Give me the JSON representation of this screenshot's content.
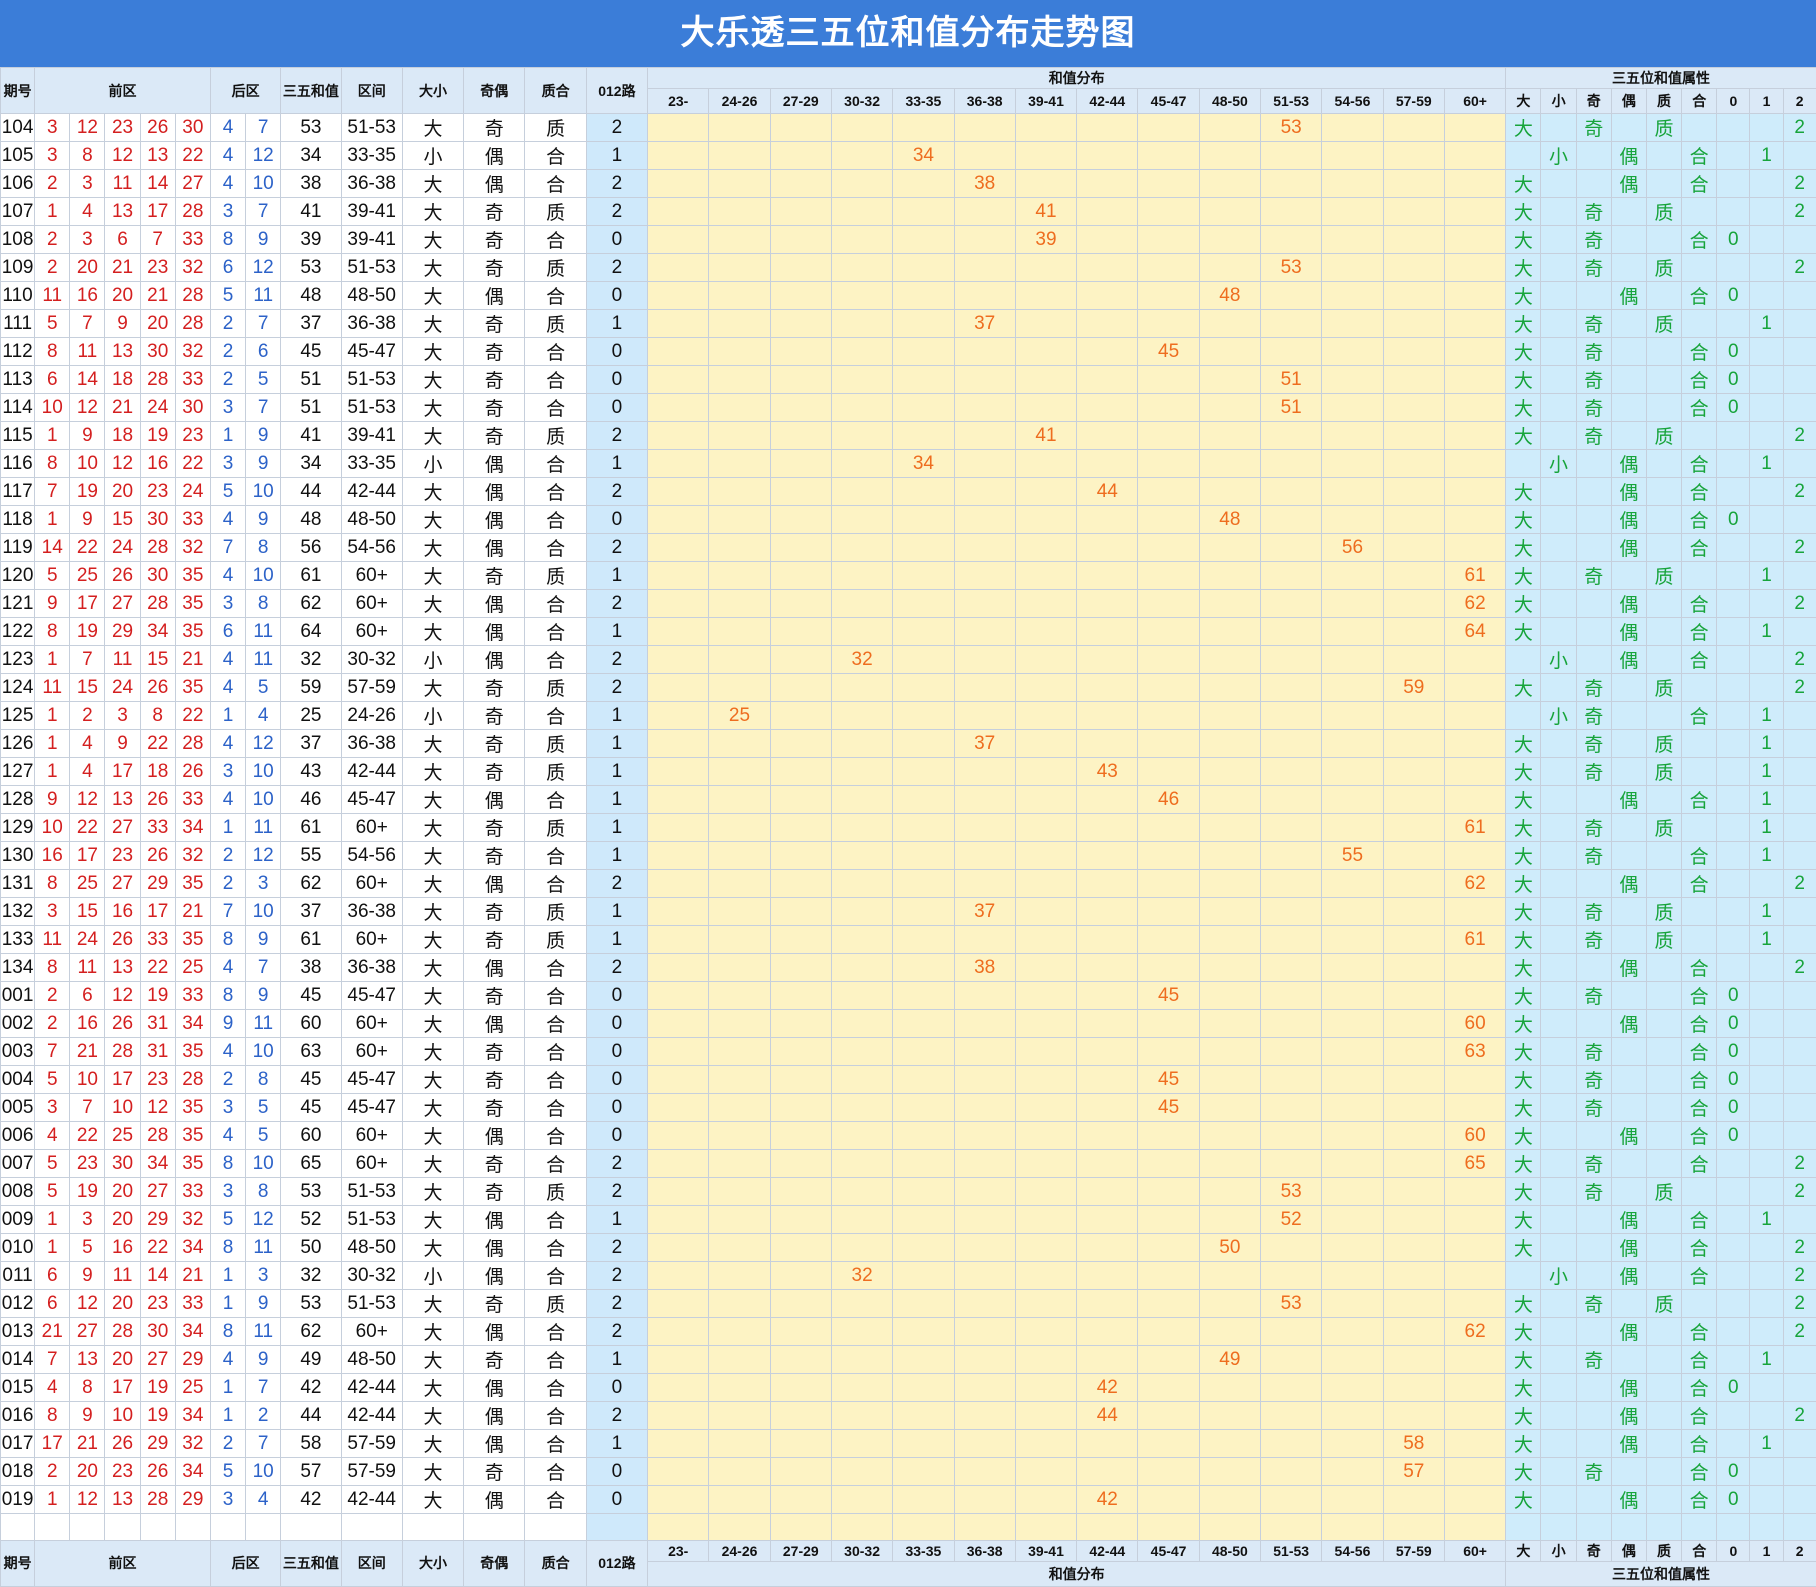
{
  "title": "大乐透三五位和值分布走势图",
  "headers": {
    "period": "期号",
    "front": "前区",
    "back": "后区",
    "sum": "三五和值",
    "segment": "区间",
    "size": "大小",
    "odd_even": "奇偶",
    "prime": "质合",
    "route": "012路",
    "dist_title": "和值分布",
    "dist_cols": [
      "23-",
      "24-26",
      "27-29",
      "30-32",
      "33-35",
      "36-38",
      "39-41",
      "42-44",
      "45-47",
      "48-50",
      "51-53",
      "54-56",
      "57-59",
      "60+"
    ],
    "attr_title": "三五位和值属性",
    "attr_cols": [
      "大",
      "小",
      "奇",
      "偶",
      "质",
      "合",
      "0",
      "1",
      "2"
    ]
  },
  "colors": {
    "title_bg": "#3b7dd8",
    "dist_bg": "#fdf3c4",
    "attr_bg": "#cfecfb",
    "front": "#d41f1f",
    "back": "#2c62c8",
    "dist_text": "#ee6d1f",
    "attr_text": "#17a43b"
  },
  "chart_data": {
    "type": "table",
    "rows": [
      {
        "p": "104",
        "f": [
          3,
          12,
          23,
          26,
          30
        ],
        "b": [
          4,
          7
        ],
        "s": 53,
        "seg": "51-53",
        "dx": "大",
        "jo": "奇",
        "zh": "质",
        "r": 2
      },
      {
        "p": "105",
        "f": [
          3,
          8,
          12,
          13,
          22
        ],
        "b": [
          4,
          12
        ],
        "s": 34,
        "seg": "33-35",
        "dx": "小",
        "jo": "偶",
        "zh": "合",
        "r": 1
      },
      {
        "p": "106",
        "f": [
          2,
          3,
          11,
          14,
          27
        ],
        "b": [
          4,
          10
        ],
        "s": 38,
        "seg": "36-38",
        "dx": "大",
        "jo": "偶",
        "zh": "合",
        "r": 2
      },
      {
        "p": "107",
        "f": [
          1,
          4,
          13,
          17,
          28
        ],
        "b": [
          3,
          7
        ],
        "s": 41,
        "seg": "39-41",
        "dx": "大",
        "jo": "奇",
        "zh": "质",
        "r": 2
      },
      {
        "p": "108",
        "f": [
          2,
          3,
          6,
          7,
          33
        ],
        "b": [
          8,
          9
        ],
        "s": 39,
        "seg": "39-41",
        "dx": "大",
        "jo": "奇",
        "zh": "合",
        "r": 0
      },
      {
        "p": "109",
        "f": [
          2,
          20,
          21,
          23,
          32
        ],
        "b": [
          6,
          12
        ],
        "s": 53,
        "seg": "51-53",
        "dx": "大",
        "jo": "奇",
        "zh": "质",
        "r": 2
      },
      {
        "p": "110",
        "f": [
          11,
          16,
          20,
          21,
          28
        ],
        "b": [
          5,
          11
        ],
        "s": 48,
        "seg": "48-50",
        "dx": "大",
        "jo": "偶",
        "zh": "合",
        "r": 0
      },
      {
        "p": "111",
        "f": [
          5,
          7,
          9,
          20,
          28
        ],
        "b": [
          2,
          7
        ],
        "s": 37,
        "seg": "36-38",
        "dx": "大",
        "jo": "奇",
        "zh": "质",
        "r": 1
      },
      {
        "p": "112",
        "f": [
          8,
          11,
          13,
          30,
          32
        ],
        "b": [
          2,
          6
        ],
        "s": 45,
        "seg": "45-47",
        "dx": "大",
        "jo": "奇",
        "zh": "合",
        "r": 0
      },
      {
        "p": "113",
        "f": [
          6,
          14,
          18,
          28,
          33
        ],
        "b": [
          2,
          5
        ],
        "s": 51,
        "seg": "51-53",
        "dx": "大",
        "jo": "奇",
        "zh": "合",
        "r": 0
      },
      {
        "p": "114",
        "f": [
          10,
          12,
          21,
          24,
          30
        ],
        "b": [
          3,
          7
        ],
        "s": 51,
        "seg": "51-53",
        "dx": "大",
        "jo": "奇",
        "zh": "合",
        "r": 0
      },
      {
        "p": "115",
        "f": [
          1,
          9,
          18,
          19,
          23
        ],
        "b": [
          1,
          9
        ],
        "s": 41,
        "seg": "39-41",
        "dx": "大",
        "jo": "奇",
        "zh": "质",
        "r": 2
      },
      {
        "p": "116",
        "f": [
          8,
          10,
          12,
          16,
          22
        ],
        "b": [
          3,
          9
        ],
        "s": 34,
        "seg": "33-35",
        "dx": "小",
        "jo": "偶",
        "zh": "合",
        "r": 1
      },
      {
        "p": "117",
        "f": [
          7,
          19,
          20,
          23,
          24
        ],
        "b": [
          5,
          10
        ],
        "s": 44,
        "seg": "42-44",
        "dx": "大",
        "jo": "偶",
        "zh": "合",
        "r": 2
      },
      {
        "p": "118",
        "f": [
          1,
          9,
          15,
          30,
          33
        ],
        "b": [
          4,
          9
        ],
        "s": 48,
        "seg": "48-50",
        "dx": "大",
        "jo": "偶",
        "zh": "合",
        "r": 0
      },
      {
        "p": "119",
        "f": [
          14,
          22,
          24,
          28,
          32
        ],
        "b": [
          7,
          8
        ],
        "s": 56,
        "seg": "54-56",
        "dx": "大",
        "jo": "偶",
        "zh": "合",
        "r": 2
      },
      {
        "p": "120",
        "f": [
          5,
          25,
          26,
          30,
          35
        ],
        "b": [
          4,
          10
        ],
        "s": 61,
        "seg": "60+",
        "dx": "大",
        "jo": "奇",
        "zh": "质",
        "r": 1
      },
      {
        "p": "121",
        "f": [
          9,
          17,
          27,
          28,
          35
        ],
        "b": [
          3,
          8
        ],
        "s": 62,
        "seg": "60+",
        "dx": "大",
        "jo": "偶",
        "zh": "合",
        "r": 2
      },
      {
        "p": "122",
        "f": [
          8,
          19,
          29,
          34,
          35
        ],
        "b": [
          6,
          11
        ],
        "s": 64,
        "seg": "60+",
        "dx": "大",
        "jo": "偶",
        "zh": "合",
        "r": 1
      },
      {
        "p": "123",
        "f": [
          1,
          7,
          11,
          15,
          21
        ],
        "b": [
          4,
          11
        ],
        "s": 32,
        "seg": "30-32",
        "dx": "小",
        "jo": "偶",
        "zh": "合",
        "r": 2
      },
      {
        "p": "124",
        "f": [
          11,
          15,
          24,
          26,
          35
        ],
        "b": [
          4,
          5
        ],
        "s": 59,
        "seg": "57-59",
        "dx": "大",
        "jo": "奇",
        "zh": "质",
        "r": 2
      },
      {
        "p": "125",
        "f": [
          1,
          2,
          3,
          8,
          22
        ],
        "b": [
          1,
          4
        ],
        "s": 25,
        "seg": "24-26",
        "dx": "小",
        "jo": "奇",
        "zh": "合",
        "r": 1
      },
      {
        "p": "126",
        "f": [
          1,
          4,
          9,
          22,
          28
        ],
        "b": [
          4,
          12
        ],
        "s": 37,
        "seg": "36-38",
        "dx": "大",
        "jo": "奇",
        "zh": "质",
        "r": 1
      },
      {
        "p": "127",
        "f": [
          1,
          4,
          17,
          18,
          26
        ],
        "b": [
          3,
          10
        ],
        "s": 43,
        "seg": "42-44",
        "dx": "大",
        "jo": "奇",
        "zh": "质",
        "r": 1
      },
      {
        "p": "128",
        "f": [
          9,
          12,
          13,
          26,
          33
        ],
        "b": [
          4,
          10
        ],
        "s": 46,
        "seg": "45-47",
        "dx": "大",
        "jo": "偶",
        "zh": "合",
        "r": 1
      },
      {
        "p": "129",
        "f": [
          10,
          22,
          27,
          33,
          34
        ],
        "b": [
          1,
          11
        ],
        "s": 61,
        "seg": "60+",
        "dx": "大",
        "jo": "奇",
        "zh": "质",
        "r": 1
      },
      {
        "p": "130",
        "f": [
          16,
          17,
          23,
          26,
          32
        ],
        "b": [
          2,
          12
        ],
        "s": 55,
        "seg": "54-56",
        "dx": "大",
        "jo": "奇",
        "zh": "合",
        "r": 1
      },
      {
        "p": "131",
        "f": [
          8,
          25,
          27,
          29,
          35
        ],
        "b": [
          2,
          3
        ],
        "s": 62,
        "seg": "60+",
        "dx": "大",
        "jo": "偶",
        "zh": "合",
        "r": 2
      },
      {
        "p": "132",
        "f": [
          3,
          15,
          16,
          17,
          21
        ],
        "b": [
          7,
          10
        ],
        "s": 37,
        "seg": "36-38",
        "dx": "大",
        "jo": "奇",
        "zh": "质",
        "r": 1
      },
      {
        "p": "133",
        "f": [
          11,
          24,
          26,
          33,
          35
        ],
        "b": [
          8,
          9
        ],
        "s": 61,
        "seg": "60+",
        "dx": "大",
        "jo": "奇",
        "zh": "质",
        "r": 1
      },
      {
        "p": "134",
        "f": [
          8,
          11,
          13,
          22,
          25
        ],
        "b": [
          4,
          7
        ],
        "s": 38,
        "seg": "36-38",
        "dx": "大",
        "jo": "偶",
        "zh": "合",
        "r": 2
      },
      {
        "p": "001",
        "f": [
          2,
          6,
          12,
          19,
          33
        ],
        "b": [
          8,
          9
        ],
        "s": 45,
        "seg": "45-47",
        "dx": "大",
        "jo": "奇",
        "zh": "合",
        "r": 0
      },
      {
        "p": "002",
        "f": [
          2,
          16,
          26,
          31,
          34
        ],
        "b": [
          9,
          11
        ],
        "s": 60,
        "seg": "60+",
        "dx": "大",
        "jo": "偶",
        "zh": "合",
        "r": 0
      },
      {
        "p": "003",
        "f": [
          7,
          21,
          28,
          31,
          35
        ],
        "b": [
          4,
          10
        ],
        "s": 63,
        "seg": "60+",
        "dx": "大",
        "jo": "奇",
        "zh": "合",
        "r": 0
      },
      {
        "p": "004",
        "f": [
          5,
          10,
          17,
          23,
          28
        ],
        "b": [
          2,
          8
        ],
        "s": 45,
        "seg": "45-47",
        "dx": "大",
        "jo": "奇",
        "zh": "合",
        "r": 0
      },
      {
        "p": "005",
        "f": [
          3,
          7,
          10,
          12,
          35
        ],
        "b": [
          3,
          5
        ],
        "s": 45,
        "seg": "45-47",
        "dx": "大",
        "jo": "奇",
        "zh": "合",
        "r": 0
      },
      {
        "p": "006",
        "f": [
          4,
          22,
          25,
          28,
          35
        ],
        "b": [
          4,
          5
        ],
        "s": 60,
        "seg": "60+",
        "dx": "大",
        "jo": "偶",
        "zh": "合",
        "r": 0
      },
      {
        "p": "007",
        "f": [
          5,
          23,
          30,
          34,
          35
        ],
        "b": [
          8,
          10
        ],
        "s": 65,
        "seg": "60+",
        "dx": "大",
        "jo": "奇",
        "zh": "合",
        "r": 2
      },
      {
        "p": "008",
        "f": [
          5,
          19,
          20,
          27,
          33
        ],
        "b": [
          3,
          8
        ],
        "s": 53,
        "seg": "51-53",
        "dx": "大",
        "jo": "奇",
        "zh": "质",
        "r": 2
      },
      {
        "p": "009",
        "f": [
          1,
          3,
          20,
          29,
          32
        ],
        "b": [
          5,
          12
        ],
        "s": 52,
        "seg": "51-53",
        "dx": "大",
        "jo": "偶",
        "zh": "合",
        "r": 1
      },
      {
        "p": "010",
        "f": [
          1,
          5,
          16,
          22,
          34
        ],
        "b": [
          8,
          11
        ],
        "s": 50,
        "seg": "48-50",
        "dx": "大",
        "jo": "偶",
        "zh": "合",
        "r": 2
      },
      {
        "p": "011",
        "f": [
          6,
          9,
          11,
          14,
          21
        ],
        "b": [
          1,
          3
        ],
        "s": 32,
        "seg": "30-32",
        "dx": "小",
        "jo": "偶",
        "zh": "合",
        "r": 2
      },
      {
        "p": "012",
        "f": [
          6,
          12,
          20,
          23,
          33
        ],
        "b": [
          1,
          9
        ],
        "s": 53,
        "seg": "51-53",
        "dx": "大",
        "jo": "奇",
        "zh": "质",
        "r": 2
      },
      {
        "p": "013",
        "f": [
          21,
          27,
          28,
          30,
          34
        ],
        "b": [
          8,
          11
        ],
        "s": 62,
        "seg": "60+",
        "dx": "大",
        "jo": "偶",
        "zh": "合",
        "r": 2
      },
      {
        "p": "014",
        "f": [
          7,
          13,
          20,
          27,
          29
        ],
        "b": [
          4,
          9
        ],
        "s": 49,
        "seg": "48-50",
        "dx": "大",
        "jo": "奇",
        "zh": "合",
        "r": 1
      },
      {
        "p": "015",
        "f": [
          4,
          8,
          17,
          19,
          25
        ],
        "b": [
          1,
          7
        ],
        "s": 42,
        "seg": "42-44",
        "dx": "大",
        "jo": "偶",
        "zh": "合",
        "r": 0
      },
      {
        "p": "016",
        "f": [
          8,
          9,
          10,
          19,
          34
        ],
        "b": [
          1,
          2
        ],
        "s": 44,
        "seg": "42-44",
        "dx": "大",
        "jo": "偶",
        "zh": "合",
        "r": 2
      },
      {
        "p": "017",
        "f": [
          17,
          21,
          26,
          29,
          32
        ],
        "b": [
          2,
          7
        ],
        "s": 58,
        "seg": "57-59",
        "dx": "大",
        "jo": "偶",
        "zh": "合",
        "r": 1
      },
      {
        "p": "018",
        "f": [
          2,
          20,
          23,
          26,
          34
        ],
        "b": [
          5,
          10
        ],
        "s": 57,
        "seg": "57-59",
        "dx": "大",
        "jo": "奇",
        "zh": "合",
        "r": 0
      },
      {
        "p": "019",
        "f": [
          1,
          12,
          13,
          28,
          29
        ],
        "b": [
          3,
          4
        ],
        "s": 42,
        "seg": "42-44",
        "dx": "大",
        "jo": "偶",
        "zh": "合",
        "r": 0
      }
    ]
  }
}
